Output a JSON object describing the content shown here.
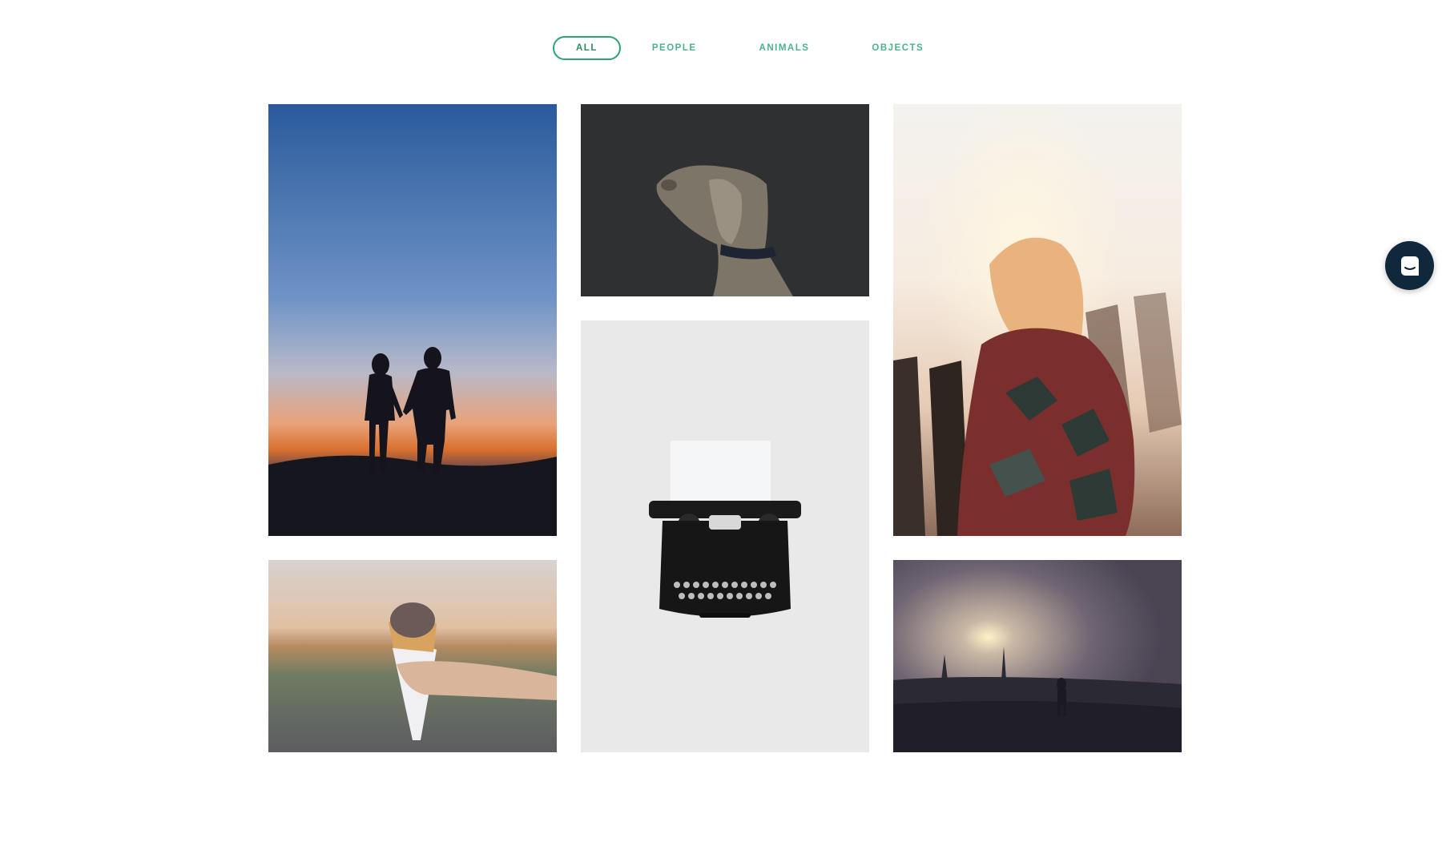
{
  "filters": {
    "items": [
      {
        "label": "ALL",
        "active": true
      },
      {
        "label": "PEOPLE",
        "active": false
      },
      {
        "label": "ANIMALS",
        "active": false
      },
      {
        "label": "OBJECTS",
        "active": false
      }
    ]
  },
  "gallery": {
    "photos": [
      {
        "subject": "couple silhouette at sunset"
      },
      {
        "subject": "dog on dark background"
      },
      {
        "subject": "woman in blanket at sunlight"
      },
      {
        "subject": "vintage typewriter"
      },
      {
        "subject": "hand holding ice cream cone"
      },
      {
        "subject": "person in foggy field at dawn"
      }
    ]
  },
  "chat": {
    "icon": "chat-icon"
  },
  "colors": {
    "accent": "#2fa36f",
    "filter_text": "#4cb389",
    "chat_bg": "#10283c",
    "background": "#ffffff"
  }
}
